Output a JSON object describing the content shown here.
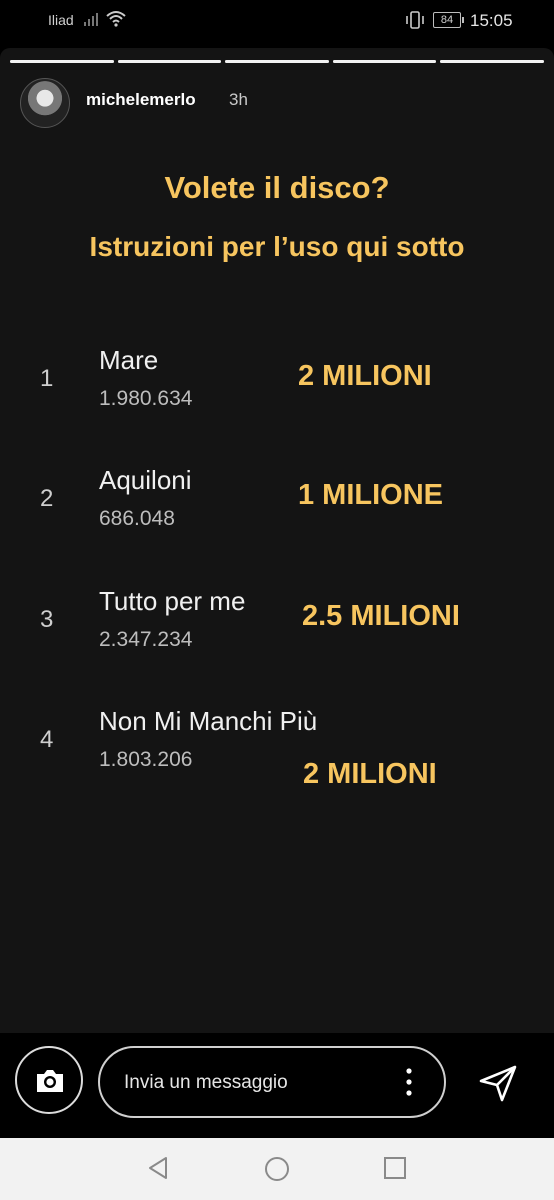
{
  "status_bar": {
    "carrier": "Iliad",
    "battery": "84",
    "time": "15:05"
  },
  "story": {
    "progress": [
      1,
      1,
      1,
      1,
      1
    ],
    "username": "michelemerlo",
    "time_ago": "3h",
    "headline": "Volete il disco?",
    "subheadline": "Istruzioni per l’uso qui sotto",
    "tracks": [
      {
        "number": "1",
        "title": "Mare",
        "plays": "1.980.634",
        "annotation": "2 MILIONI"
      },
      {
        "number": "2",
        "title": "Aquiloni",
        "plays": "686.048",
        "annotation": "1 MILIONE"
      },
      {
        "number": "3",
        "title": "Tutto per me",
        "plays": "2.347.234",
        "annotation": "2.5 MILIONI"
      },
      {
        "number": "4",
        "title": "Non Mi Manchi Più",
        "plays": "1.803.206",
        "annotation": "2 MILIONI"
      }
    ]
  },
  "reply_bar": {
    "placeholder": "Invia un messaggio"
  },
  "icons": {
    "camera": "camera-icon",
    "more": "more-vertical-icon",
    "send": "send-icon",
    "back": "nav-back-icon",
    "home": "nav-home-icon",
    "recents": "nav-recents-icon"
  },
  "colors": {
    "accent_yellow": "#f7c55f",
    "story_bg": "#141414"
  }
}
